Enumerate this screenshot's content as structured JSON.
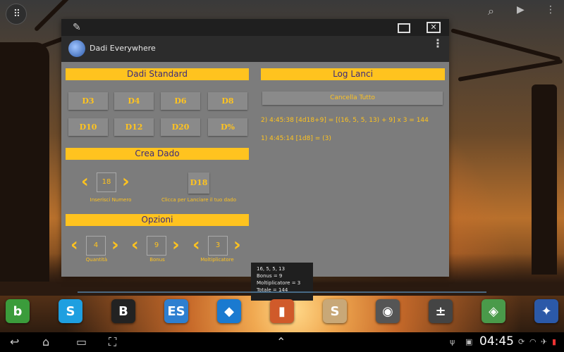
{
  "window": {
    "app_title": "Dadi Everywhere"
  },
  "standard": {
    "header": "Dadi Standard",
    "dice": [
      "D3",
      "D4",
      "D6",
      "D8",
      "D10",
      "D12",
      "D20",
      "D%"
    ]
  },
  "create": {
    "header": "Crea Dado",
    "value": "18",
    "value_label": "Inserisci Numero",
    "die_button": "D18",
    "die_label": "Clicca per Lanciare il tuo dado"
  },
  "options": {
    "header": "Opzioni",
    "quantity_value": "4",
    "quantity_label": "Quantità",
    "bonus_value": "9",
    "bonus_label": "Bonus",
    "multiplier_value": "3",
    "multiplier_label": "Moltiplicatore"
  },
  "log": {
    "header": "Log Lanci",
    "cancel_label": "Cancella Tutto",
    "entries": [
      "2) 4:45:38 [4d18+9] = [(16, 5, 5, 13) + 9] x 3 = 144",
      "1) 4:45:14 [1d8] = (3)"
    ]
  },
  "tooltip": {
    "lines": [
      "16, 5, 5, 13",
      "Bonus = 9",
      "Moltiplicatore = 3",
      "Totale = 144"
    ]
  },
  "status": {
    "time": "04:45"
  },
  "dock_apps": [
    {
      "name": "bing",
      "glyph": "b",
      "color": "#3b9c3b"
    },
    {
      "name": "skype",
      "glyph": "S",
      "color": "#1e9fe0"
    },
    {
      "name": "bitcoin",
      "glyph": "B",
      "color": "#222222"
    },
    {
      "name": "es-file-explorer",
      "glyph": "ES",
      "color": "#2e7fd0"
    },
    {
      "name": "dropbox",
      "glyph": "◆",
      "color": "#1a7ad0"
    },
    {
      "name": "cards",
      "glyph": "▮",
      "color": "#d05a2a"
    },
    {
      "name": "scrabble",
      "glyph": "S",
      "color": "#c8a878"
    },
    {
      "name": "camera",
      "glyph": "◉",
      "color": "#555555"
    },
    {
      "name": "calculator",
      "glyph": "±",
      "color": "#444444"
    },
    {
      "name": "maps",
      "glyph": "◈",
      "color": "#4a9a4a"
    },
    {
      "name": "dadi-everywhere",
      "glyph": "✦",
      "color": "#2b59a8"
    }
  ],
  "colors": {
    "accent": "#ffc31f",
    "window_bg": "#7c7c7c",
    "header_text": "#3a2a7a"
  }
}
